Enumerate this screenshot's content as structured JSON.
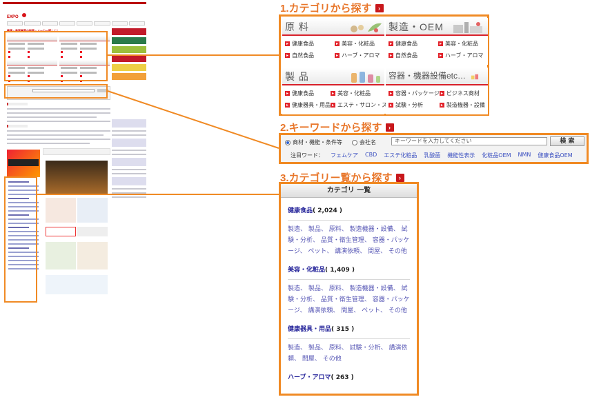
{
  "colors": {
    "accent_orange": "#f08a24",
    "brand_red": "#d8202a",
    "link_blue": "#3a4fc0",
    "link_purple": "#29289c"
  },
  "section1": {
    "heading": "1.カテゴリから探す",
    "categories": [
      {
        "title": "原 料",
        "items": [
          "健康食品",
          "美容・化粧品",
          "自然食品",
          "ハーブ・アロマ"
        ]
      },
      {
        "title": "製造・OEM",
        "items": [
          "健康食品",
          "美容・化粧品",
          "自然食品",
          "ハーブ・アロマ"
        ]
      },
      {
        "title": "製 品",
        "items": [
          "健康食品",
          "美容・化粧品",
          "健康器具・用品",
          "エステ・サロン・スパ"
        ]
      },
      {
        "title": "容器・機器設備etc…",
        "items": [
          "容器・パッケージ",
          "ビジネス商材",
          "試験・分析",
          "製造機器・設備"
        ]
      }
    ]
  },
  "section2": {
    "heading": "2.キーワードから探す",
    "radio1": "商材・機能・条件等",
    "radio2": "会社名",
    "placeholder": "キーワードを入力してください",
    "button": "検 索",
    "tags_label": "注目ワード：",
    "tags": [
      "フェムケア",
      "CBD",
      "エステ化粧品",
      "乳酸菌",
      "機能性表示",
      "化粧品OEM",
      "NMN",
      "健康食品OEM"
    ]
  },
  "section3": {
    "heading": "3.カテゴリー覧から探す",
    "list_title": "カテゴリ 一覧",
    "groups": [
      {
        "name": "健康食品",
        "count": "( 2,024 )",
        "subs": "製造、 製品、 原料、 製造機器・設備、 試験・分析、 品質・衛生管理、 容器・パッケージ、 ペット、 講演依頼、 問屋、 その他"
      },
      {
        "name": "美容・化粧品",
        "count": "( 1,409 )",
        "subs": "製造、 製品、 原料、 製造機器・設備、 試験・分析、 品質・衛生管理、 容器・パッケージ、 講演依頼、 問屋、 ペット、 その他"
      },
      {
        "name": "健康器具・用品",
        "count": "( 315 )",
        "subs": "製造、 製品、 原料、 試験・分析、 講演依頼、 問屋、 その他"
      },
      {
        "name": "ハーブ・アロマ",
        "count": "( 263 )",
        "subs": ""
      }
    ]
  },
  "thumb": {
    "logo": "EXPO",
    "headline": "健康・美容業界の販売・メーカー探しに！"
  }
}
